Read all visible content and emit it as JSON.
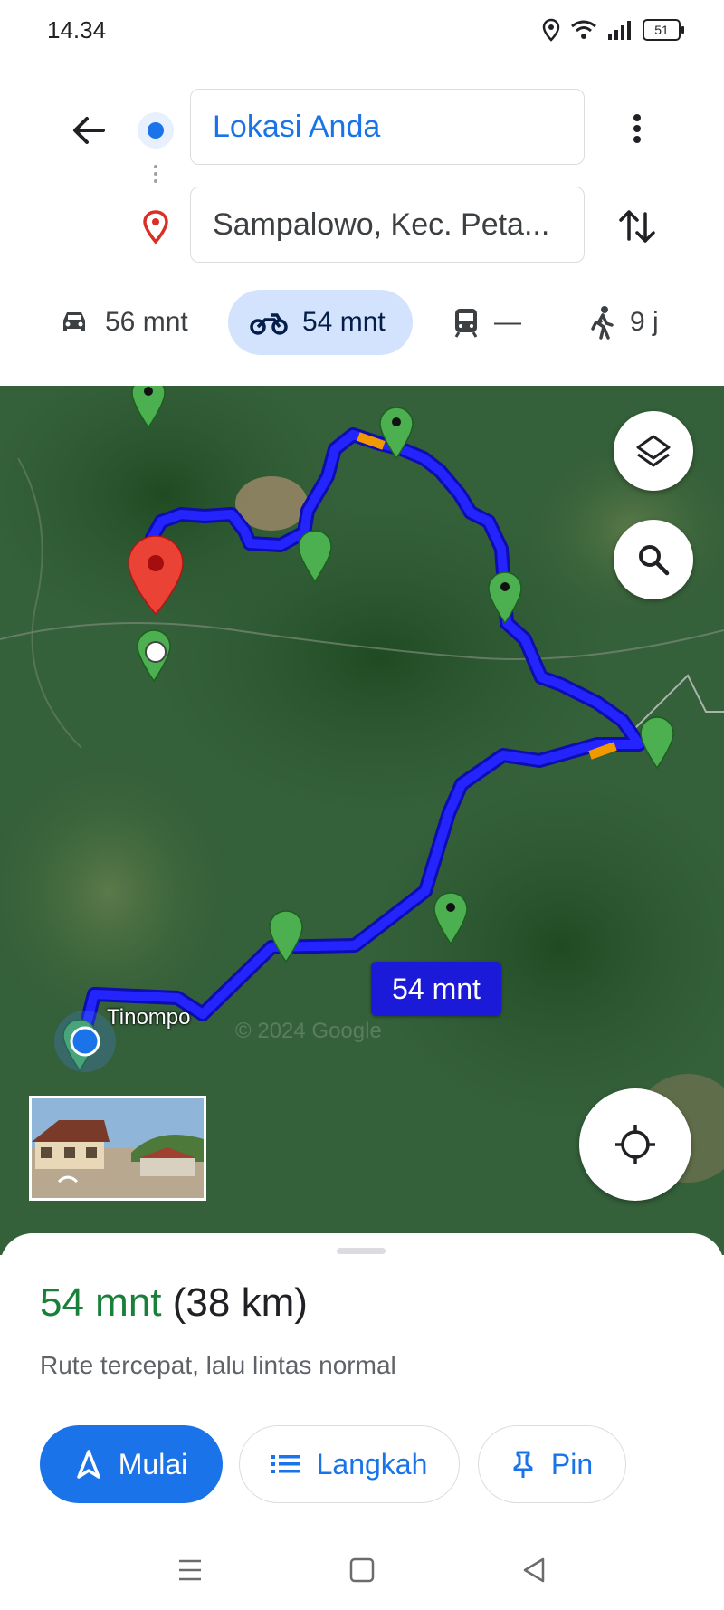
{
  "status_bar": {
    "time": "14.34",
    "battery": "51"
  },
  "directions": {
    "origin": "Lokasi Anda",
    "destination": "Sampalowo, Kec. Peta..."
  },
  "modes": [
    {
      "name": "car",
      "label": "56 mnt",
      "active": false
    },
    {
      "name": "motorcycle",
      "label": "54 mnt",
      "active": true
    },
    {
      "name": "transit",
      "label": "—",
      "active": false
    },
    {
      "name": "walk",
      "label": "9 j",
      "active": false
    }
  ],
  "map": {
    "eta_label": "54 mnt",
    "place_label": "Tinompo",
    "watermark": "© 2024 Google"
  },
  "sheet": {
    "duration": "54 mnt",
    "distance": "(38 km)",
    "description": "Rute tercepat, lalu lintas normal",
    "buttons": {
      "start": "Mulai",
      "steps": "Langkah",
      "pin": "Pin"
    }
  },
  "colors": {
    "accent": "#1a73e8",
    "duration_green": "#188038",
    "route": "#1a1aff",
    "active_mode_bg": "#d3e3fd"
  }
}
